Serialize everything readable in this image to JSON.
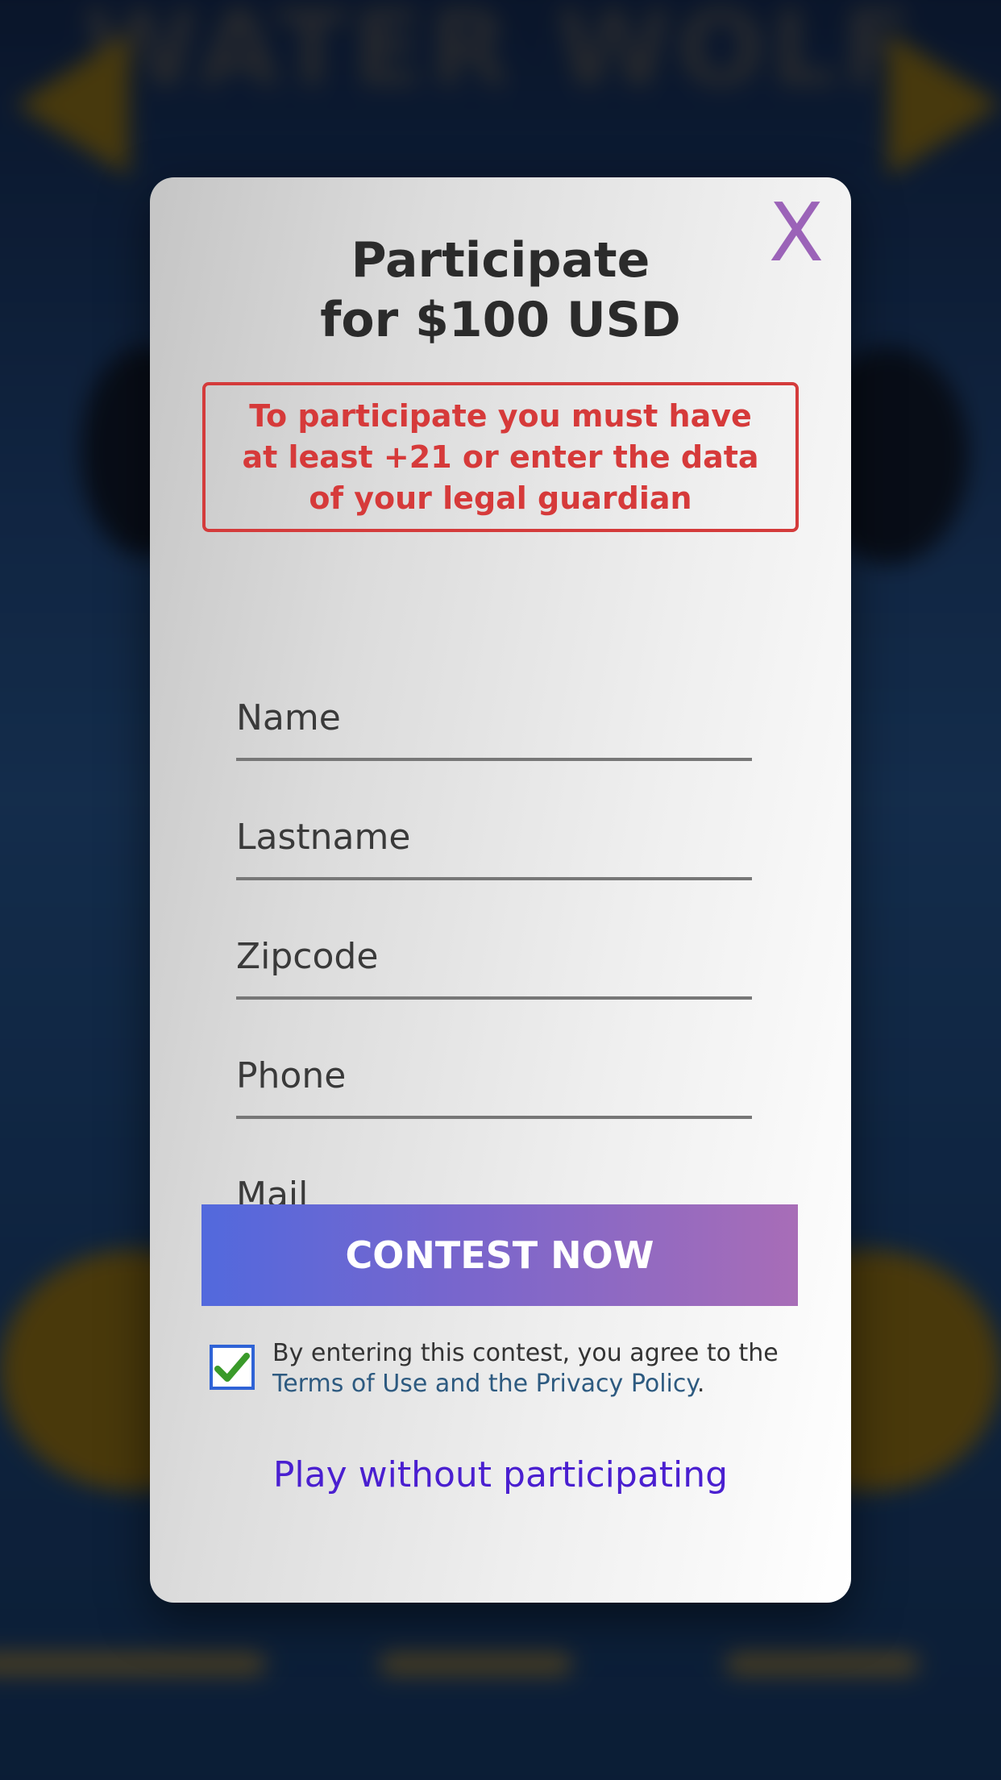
{
  "background": {
    "game_title": "WATER WOLF"
  },
  "modal": {
    "close_label": "X",
    "title_line1": "Participate",
    "title_line2": "for $100 USD",
    "warning_line1": "To participate you must have",
    "warning_line2": "at least +21 or enter the data",
    "warning_line3": "of your legal guardian",
    "fields": {
      "name": {
        "placeholder": "Name",
        "value": ""
      },
      "lastname": {
        "placeholder": "Lastname",
        "value": ""
      },
      "zipcode": {
        "placeholder": "Zipcode",
        "value": ""
      },
      "phone": {
        "placeholder": "Phone",
        "value": ""
      },
      "mail": {
        "placeholder": "Mail",
        "value": ""
      }
    },
    "contest_button": "CONTEST NOW",
    "agree_checked": true,
    "agree_text": "By entering this contest, you agree to the",
    "terms_link": "Terms of Use and the Privacy Policy",
    "terms_period": ".",
    "play_link": "Play without participating"
  },
  "colors": {
    "accent_purple": "#9b63b8",
    "warning_red": "#d63a3a",
    "button_gradient_start": "#5269dd",
    "button_gradient_end": "#a86db7",
    "link_blue": "#2d5a80",
    "play_link_color": "#4a1fd0",
    "checkmark_green": "#3a9a2a"
  }
}
